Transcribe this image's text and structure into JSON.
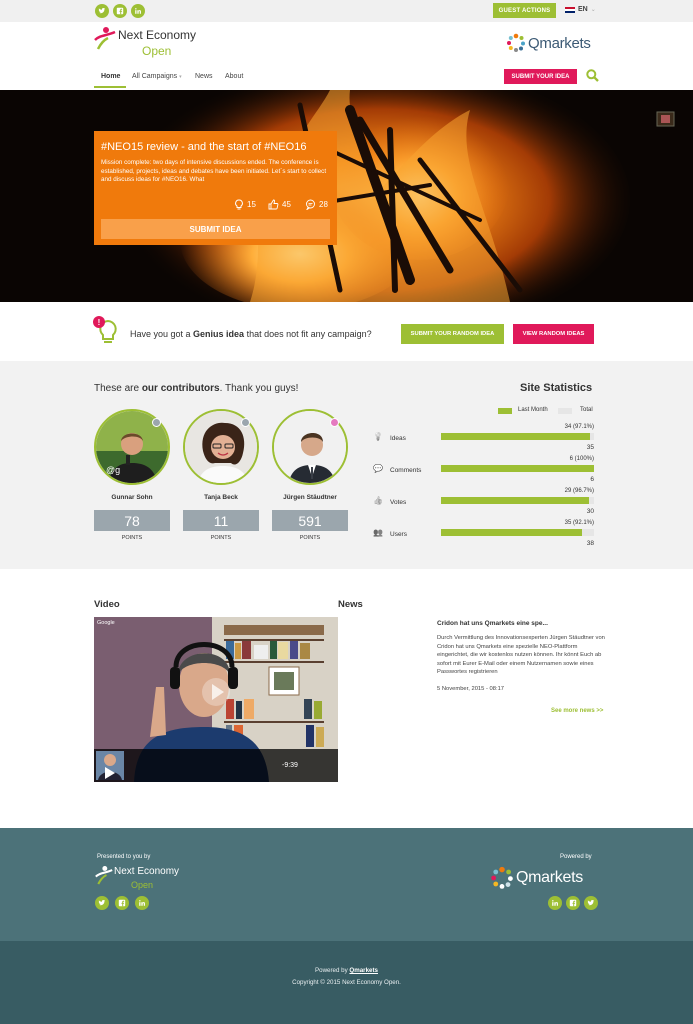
{
  "topbar": {
    "social": [
      "twitter-icon",
      "facebook-icon",
      "linkedin-icon"
    ],
    "guest_actions": "GUEST ACTIONS",
    "language": "EN"
  },
  "header": {
    "logo_line1": "Next Economy",
    "logo_line2": "Open",
    "partner_logo": "Qmarkets",
    "nav": [
      {
        "label": "Home",
        "active": true
      },
      {
        "label": "All Campaigns",
        "dropdown": true
      },
      {
        "label": "News"
      },
      {
        "label": "About"
      }
    ],
    "submit_idea": "SUBMIT YOUR IDEA"
  },
  "hero": {
    "title": "#NEO15 review - and the start of #NEO16",
    "text": "Mission complete: two days of intensive discussions ended. The conference is established, projects, ideas and debates have been initiated. Let´s start to collect and discuss ideas for #NEO16. What",
    "ideas_count": "15",
    "likes_count": "45",
    "comments_count": "28",
    "button": "SUBMIT IDEA"
  },
  "genius": {
    "text_before": "Have you got a ",
    "text_bold": "Genius idea",
    "text_after": " that does not fit any campaign?",
    "button_submit": "SUBMIT YOUR RANDOM IDEA",
    "button_view": "VIEW RANDOM IDEAS"
  },
  "contributors": {
    "title_before": "These are ",
    "title_bold": "our contributors",
    "title_after": ". Thank you guys!",
    "people": [
      {
        "name": "Gunnar Sohn",
        "points": "78",
        "points_label": "POINTS"
      },
      {
        "name": "Tanja Beck",
        "points": "11",
        "points_label": "POINTS"
      },
      {
        "name": "Jürgen Stäudtner",
        "points": "591",
        "points_label": "POINTS"
      }
    ]
  },
  "site_statistics": {
    "title": "Site Statistics",
    "legend_last_month": "Last Month",
    "legend_total": "Total",
    "rows": [
      {
        "label": "Ideas",
        "value_label": "34 (97.1%)",
        "total": "35",
        "fraction": 0.971
      },
      {
        "label": "Comments",
        "value_label": "6 (100%)",
        "total": "6",
        "fraction": 1.0
      },
      {
        "label": "Votes",
        "value_label": "29 (96.7%)",
        "total": "30",
        "fraction": 0.967
      },
      {
        "label": "Users",
        "value_label": "35 (92.1%)",
        "total": "38",
        "fraction": 0.921
      }
    ]
  },
  "video": {
    "title": "Video",
    "channel": "Google",
    "time": "-9:39"
  },
  "news": {
    "title": "News",
    "headline": "Cridon hat uns Qmarkets eine spe...",
    "body": "Durch Vermittlung des Innovationsexperten Jürgen Stäudtner von Cridon hat uns Qmarkets eine spezielle NEO-Plattform eingerichtet, die wir kostenlos nutzen können. Ihr könnt Euch ab sofort mit Eurer E-Mail oder einem Nutzernamen sowie eines Passwortes registrieren",
    "date": "5 November, 2015 - 08:17",
    "more": "See more news >>"
  },
  "footer": {
    "presented_by": "Presented to you by",
    "powered_by": "Powered by",
    "logo_line1": "Next Economy",
    "logo_line2": "Open",
    "partner_logo": "Qmarkets",
    "powered_text": "Powered by ",
    "powered_link": "Qmarkets",
    "copyright": "Copyright © 2015 Next Economy Open."
  },
  "colors": {
    "accent_green": "#9dbf34",
    "accent_pink": "#e0195a",
    "hero_orange": "#f07a0c",
    "footer_teal": "#4c7279",
    "footer_dark": "#385c63"
  }
}
